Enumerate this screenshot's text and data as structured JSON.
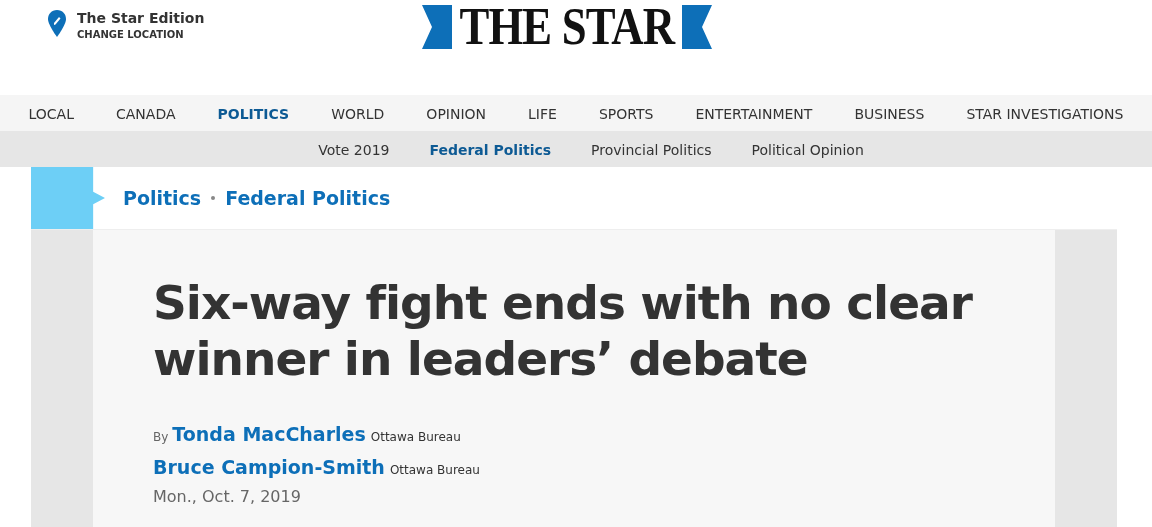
{
  "edition": {
    "title": "The Star Edition",
    "action": "CHANGE LOCATION"
  },
  "logo": {
    "text": "THE STAR"
  },
  "main_nav": [
    {
      "label": "LOCAL",
      "selected": false
    },
    {
      "label": "CANADA",
      "selected": false
    },
    {
      "label": "POLITICS",
      "selected": true
    },
    {
      "label": "WORLD",
      "selected": false
    },
    {
      "label": "OPINION",
      "selected": false
    },
    {
      "label": "LIFE",
      "selected": false
    },
    {
      "label": "SPORTS",
      "selected": false
    },
    {
      "label": "ENTERTAINMENT",
      "selected": false
    },
    {
      "label": "BUSINESS",
      "selected": false
    },
    {
      "label": "STAR INVESTIGATIONS",
      "selected": false
    }
  ],
  "sub_nav": [
    {
      "label": "Vote 2019",
      "selected": false
    },
    {
      "label": "Federal Politics",
      "selected": true
    },
    {
      "label": "Provincial Politics",
      "selected": false
    },
    {
      "label": "Political Opinion",
      "selected": false
    }
  ],
  "breadcrumb": [
    "Politics",
    "Federal Politics"
  ],
  "article": {
    "headline": "Six-way fight ends with no clear winner in leaders’ debate",
    "by": "By",
    "authors": [
      {
        "name": "Tonda MacCharles",
        "bureau": "Ottawa Bureau"
      },
      {
        "name": "Bruce Campion-Smith",
        "bureau": "Ottawa Bureau"
      }
    ],
    "date": "Mon., Oct. 7, 2019"
  }
}
